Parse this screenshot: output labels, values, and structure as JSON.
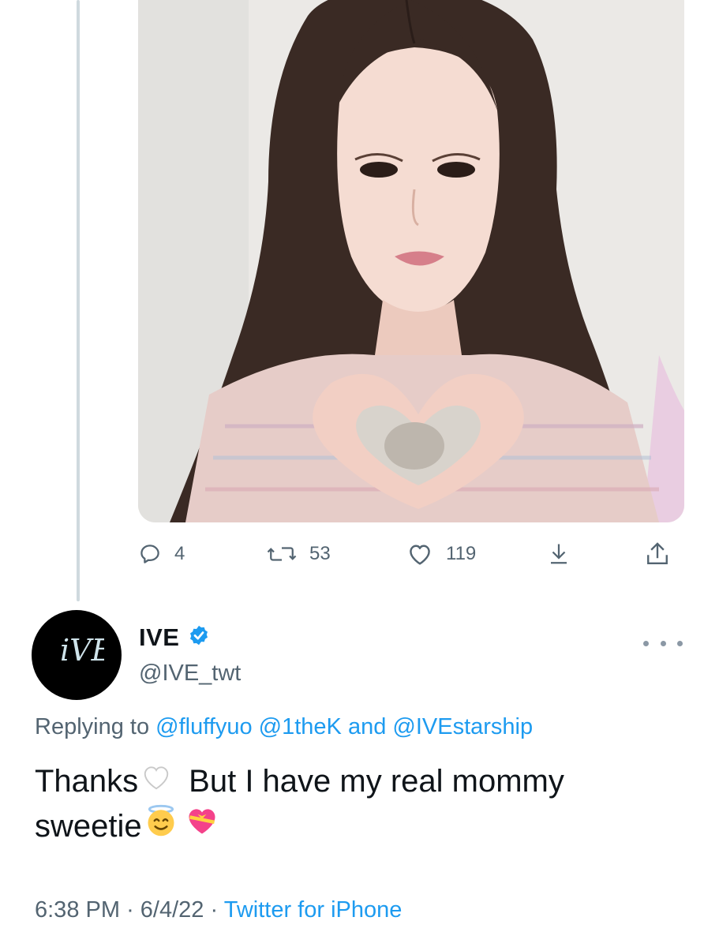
{
  "reply_stats": {
    "replies": "4",
    "retweets": "53",
    "likes": "119"
  },
  "author": {
    "display_name": "IVE",
    "handle": "@IVE_twt",
    "verified": true,
    "avatar_text": "iVE"
  },
  "replying": {
    "prefix": "Replying to",
    "mention_1": "@fluffyuo",
    "mention_2": "@1theK",
    "conjunction": "and",
    "mention_3": "@IVEstarship"
  },
  "tweet": {
    "line1_a": "Thanks",
    "line1_b": "But I have my real mommy",
    "line2": "sweetie"
  },
  "meta": {
    "time": "6:38 PM",
    "sep1": "·",
    "date": "6/4/22",
    "sep2": "·",
    "source": "Twitter for iPhone"
  },
  "icons": {
    "reply": "reply-icon",
    "retweet": "retweet-icon",
    "like": "heart-icon",
    "bookmark": "bookmark-download-icon",
    "share": "share-icon",
    "verified": "verified-badge-icon",
    "more": "more-options-icon"
  },
  "colors": {
    "accent": "#1d9bf0",
    "secondary_text": "#536471",
    "primary_text": "#0f1419"
  }
}
